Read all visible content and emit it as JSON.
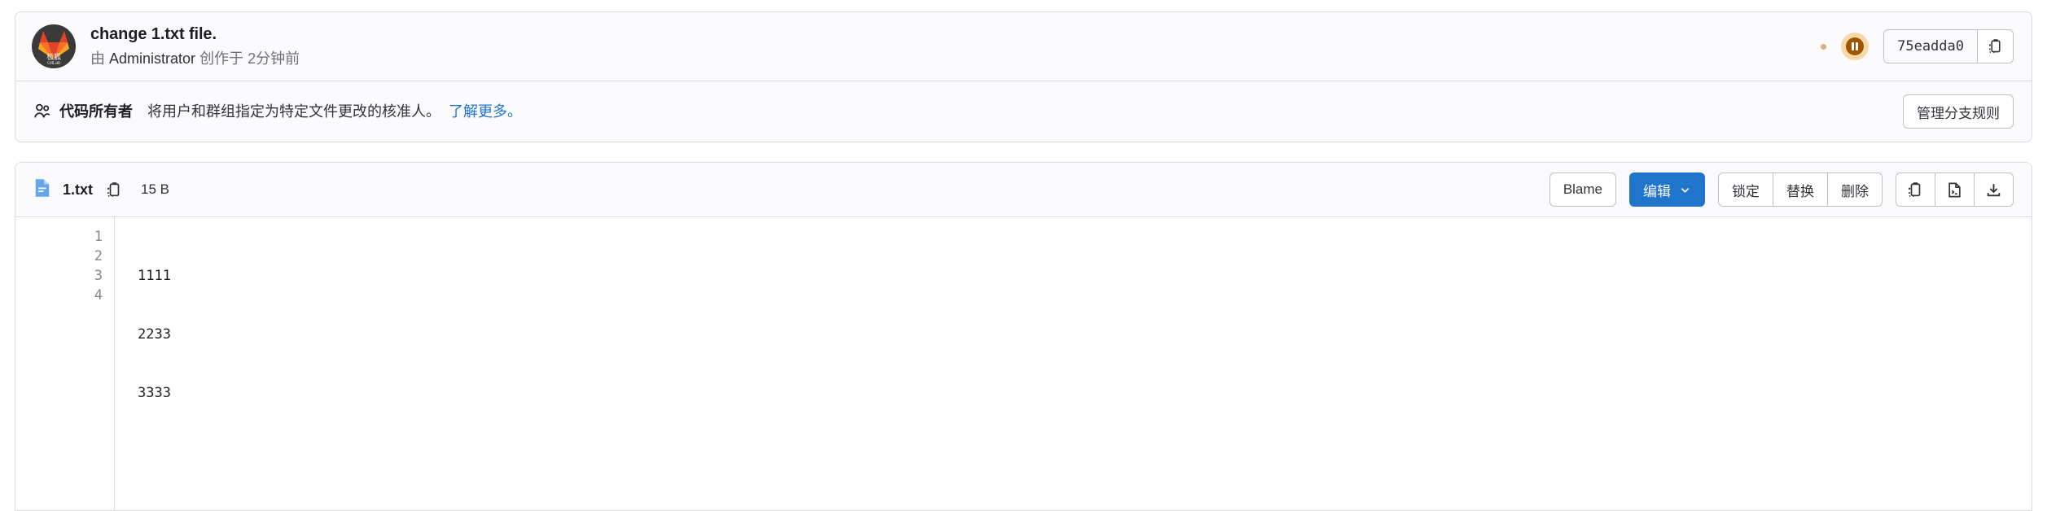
{
  "commit": {
    "title": "change 1.txt file.",
    "byline_prefix": "由",
    "author": "Administrator",
    "byline_middle": "创作于",
    "time_ago": "2分钟前",
    "avatar_label": "极狐",
    "avatar_sublabel": "GitLab",
    "pipeline_status": "paused",
    "sha": "75eadda0",
    "copy_sha_icon": "copy-icon"
  },
  "codeowners": {
    "icon": "users-icon",
    "title": "代码所有者",
    "description": "将用户和群组指定为特定文件更改的核准人。",
    "link_label": "了解更多。",
    "manage_button": "管理分支规则"
  },
  "file": {
    "icon": "document-icon",
    "name": "1.txt",
    "copy_path_icon": "copy-icon",
    "size": "15 B",
    "actions": {
      "blame": "Blame",
      "edit": "编辑",
      "edit_chevron": "chevron-down-icon",
      "lock": "锁定",
      "replace": "替换",
      "delete": "删除",
      "copy_contents_icon": "copy-icon",
      "open_raw_icon": "raw-file-icon",
      "download_icon": "download-icon"
    },
    "lines": [
      {
        "number": "1",
        "text": "1111"
      },
      {
        "number": "2",
        "text": "2233"
      },
      {
        "number": "3",
        "text": "3333"
      },
      {
        "number": "4",
        "text": ""
      }
    ]
  },
  "colors": {
    "accent": "#1f75cb",
    "link": "#1f75cb",
    "paused_badge_bg": "#f5d9a8",
    "paused_badge_fg": "#9e5400",
    "file_icon": "#63a6e9"
  }
}
